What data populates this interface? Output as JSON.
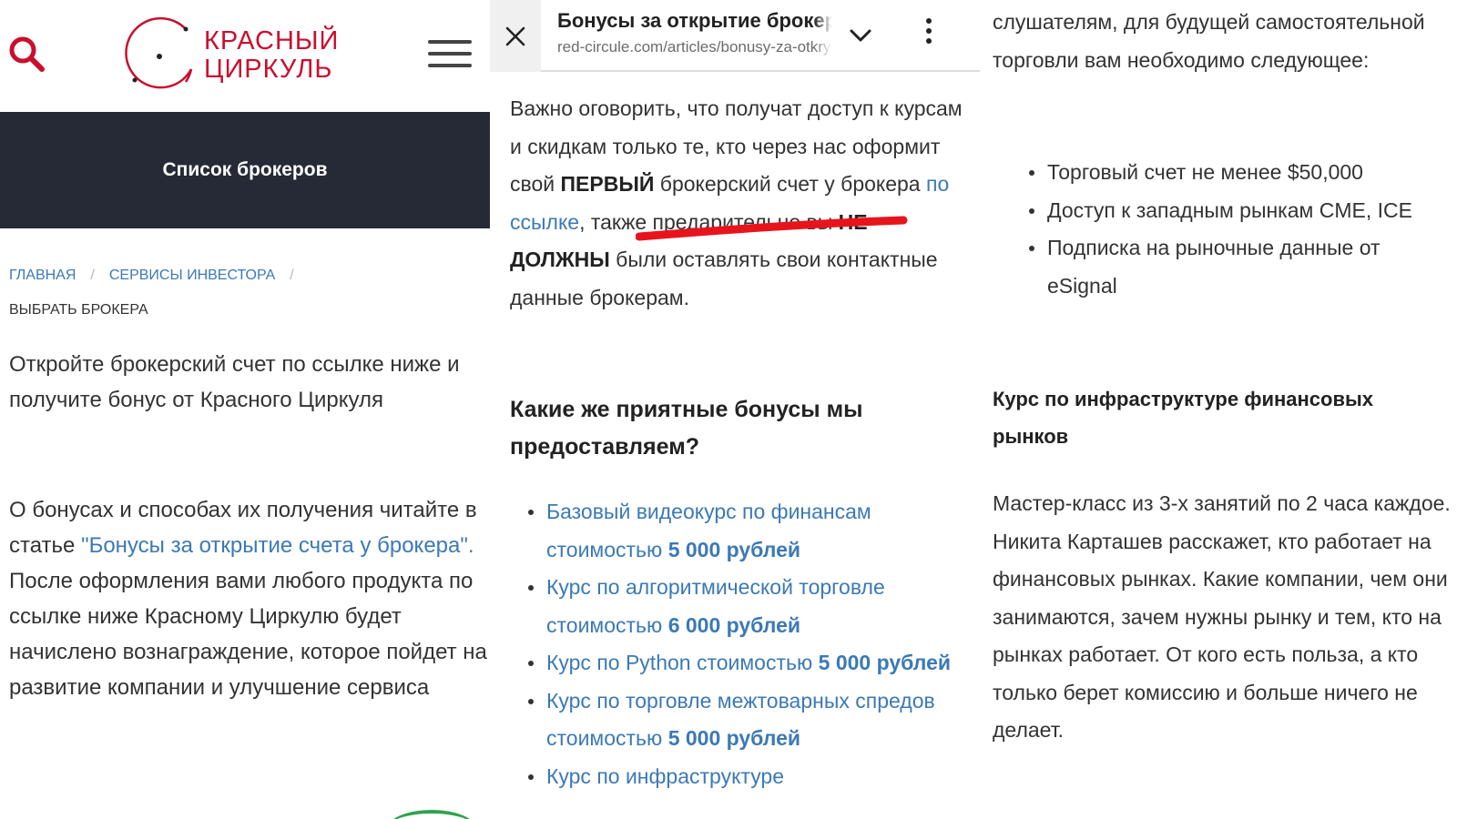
{
  "colors": {
    "brand": "#c8102e",
    "link": "#3b79b6",
    "band": "#252a36",
    "annotation": "#e8141c"
  },
  "site": {
    "logo": {
      "line1": "КРАСНЫЙ",
      "line2": "ЦИРКУЛЬ"
    },
    "search_icon": "search-icon",
    "menu_icon": "hamburger-menu-icon",
    "band_title": "Список брокеров",
    "breadcrumb": {
      "items": [
        "ГЛАВНАЯ",
        "СЕРВИСЫ ИНВЕСТОРА"
      ],
      "separator": "/",
      "current": "ВЫБРАТЬ БРОКЕРА"
    },
    "lead": "Откройте брокерский счет по ссылке ниже и получите бонус от Красного Циркуля",
    "body": {
      "before": "О бонусах и способах их получения читайте в статье ",
      "link": "\"Бонусы за открытие счета у брокера\".",
      "after": " После оформления вами любого продукта по ссылке ниже Красному Циркулю будет начислено вознаграждение, которое пойдет на развитие компании и улучшение сервиса"
    }
  },
  "browser": {
    "close_icon": "close-icon",
    "title": "Бонусы за открытие брокерского счета",
    "url": "red-circule.com/articles/bonusy-za-otkrytie-scheta",
    "chevron_icon": "chevron-down-icon",
    "more_icon": "more-vertical-icon"
  },
  "article": {
    "para": {
      "t1": "Важно оговорить, что получат доступ к курсам и скидкам только те, кто через нас оформит свой ",
      "b1": "ПЕРВЫЙ",
      "t2": " брокерский счет у брокера ",
      "link": "по ссылке",
      "t3": ", также предарительно вы ",
      "b2": "НЕ ДОЛЖНЫ",
      "t4": " были оставлять свои контактные данные брокерам."
    },
    "heading": "Какие же приятные бонусы мы предоставляем?",
    "bonuses": [
      {
        "text": "Базовый видеокурс по финансам стоимостью ",
        "price": "5 000 рублей"
      },
      {
        "text": "Курс по алгоритмической торговле стоимостью ",
        "price": "6 000 рублей"
      },
      {
        "text": "Курс по Python стоимостью ",
        "price": "5 000 рублей"
      },
      {
        "text": "Курс по торговле межтоварных спредов стоимостью ",
        "price": "5 000 рублей"
      },
      {
        "text": "Курс по инфраструктуре",
        "price": ""
      }
    ]
  },
  "requirements": {
    "intro": "слушателям, для будущей самостоятельной торговли вам необходимо следующее:",
    "items": [
      "Торговый счет не менее $50,000",
      "Доступ к западным рынкам CME, ICE",
      "Подписка на рыночные данные от eSignal"
    ],
    "heading": "Курс по инфраструктуре финансовых рынков",
    "text": "Мастер-класс из 3-х занятий по 2 часа каждое. Никита Карташев расскажет, кто работает на финансовых рынках. Какие компании, чем они занимаются, зачем нужны рынку и тем, кто на рынках работает. От кого есть польза, а кто только берет комиссию и больше ничего не делает."
  }
}
